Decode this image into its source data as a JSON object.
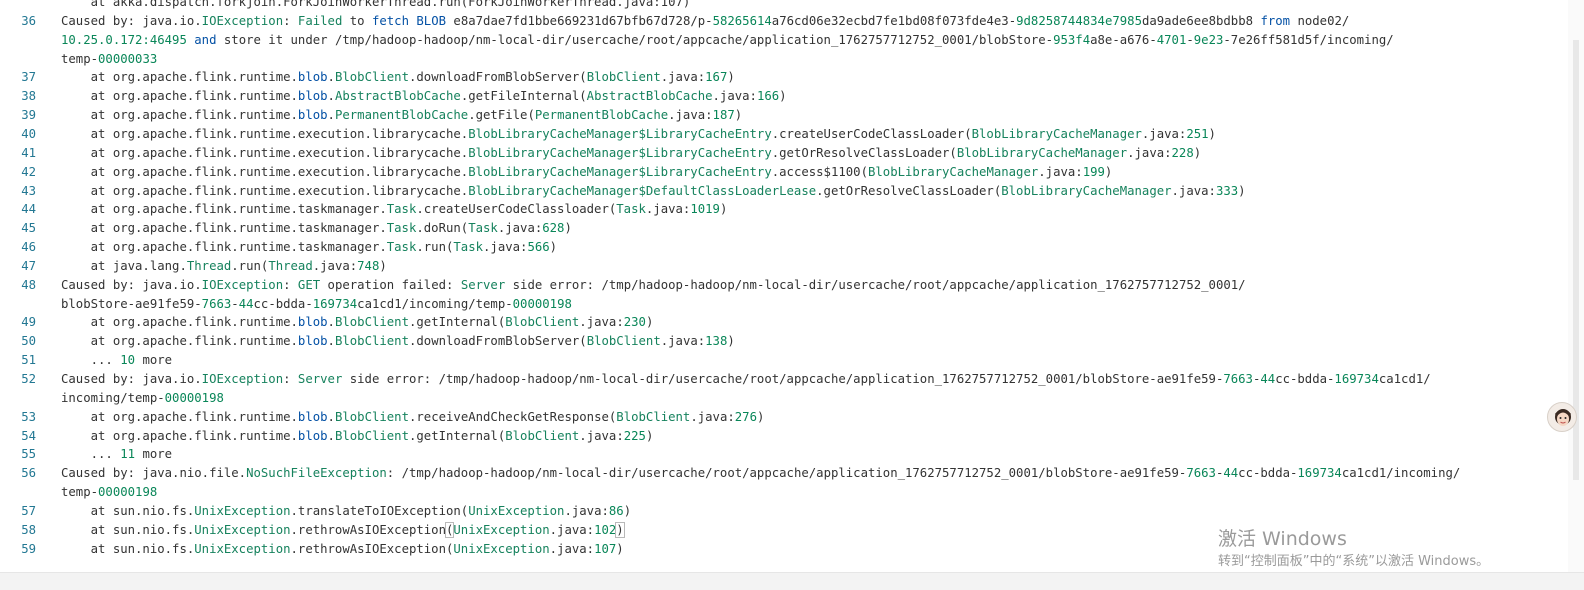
{
  "editor": {
    "lines": [
      {
        "num": "",
        "top": 0,
        "segments": [
          {
            "t": "    at akka.dispatch.forkjoin.ForkJoinWorkerThread.run(ForkJoinWorkerThread.java:107)"
          }
        ]
      },
      {
        "num": "36",
        "segments": [
          {
            "t": "Caused by: "
          },
          {
            "t": "java.io.",
            "c": "p"
          },
          {
            "t": "IOException",
            "c": "t"
          },
          {
            "t": ": "
          },
          {
            "t": "Failed",
            "c": "t"
          },
          {
            "t": " to "
          },
          {
            "t": "fetch",
            "c": "k"
          },
          {
            "t": " "
          },
          {
            "t": "BLOB",
            "c": "k"
          },
          {
            "t": " e8a7dae7fd1bbe669231d67bfb67d728/p-"
          },
          {
            "t": "58265614",
            "c": "n"
          },
          {
            "t": "a76cd06e32ecbd7fe1bd08f073fde4e3-"
          },
          {
            "t": "9d8258744834e7985",
            "c": "n"
          },
          {
            "t": "da9ade6ee8bdbb8 "
          },
          {
            "t": "from",
            "c": "k"
          },
          {
            "t": " node02/"
          }
        ]
      },
      {
        "num": "",
        "segments": [
          {
            "t": "10.25.0.172:46495",
            "c": "n"
          },
          {
            "t": " "
          },
          {
            "t": "and",
            "c": "k"
          },
          {
            "t": " store it under /tmp/hadoop-hadoop/nm-local-dir/usercache/root/appcache/application_1762757712752_0001/blobStore-"
          },
          {
            "t": "953f4",
            "c": "n"
          },
          {
            "t": "a8e-a676-"
          },
          {
            "t": "4701",
            "c": "n"
          },
          {
            "t": "-"
          },
          {
            "t": "9e23",
            "c": "n"
          },
          {
            "t": "-7e26ff581d5f/incoming/"
          }
        ]
      },
      {
        "num": "",
        "segments": [
          {
            "t": "temp-"
          },
          {
            "t": "00000033",
            "c": "n"
          }
        ]
      },
      {
        "num": "37",
        "segments": [
          {
            "t": "    at org.apache.flink.runtime."
          },
          {
            "t": "blob",
            "c": "k"
          },
          {
            "t": "."
          },
          {
            "t": "BlobClient",
            "c": "t"
          },
          {
            "t": ".downloadFromBlobServer("
          },
          {
            "t": "BlobClient",
            "c": "t"
          },
          {
            "t": ".java:"
          },
          {
            "t": "167",
            "c": "n"
          },
          {
            "t": ")"
          }
        ]
      },
      {
        "num": "38",
        "segments": [
          {
            "t": "    at org.apache.flink.runtime."
          },
          {
            "t": "blob",
            "c": "k"
          },
          {
            "t": "."
          },
          {
            "t": "AbstractBlobCache",
            "c": "t"
          },
          {
            "t": ".getFileInternal("
          },
          {
            "t": "AbstractBlobCache",
            "c": "t"
          },
          {
            "t": ".java:"
          },
          {
            "t": "166",
            "c": "n"
          },
          {
            "t": ")"
          }
        ]
      },
      {
        "num": "39",
        "segments": [
          {
            "t": "    at org.apache.flink.runtime."
          },
          {
            "t": "blob",
            "c": "k"
          },
          {
            "t": "."
          },
          {
            "t": "PermanentBlobCache",
            "c": "t"
          },
          {
            "t": ".getFile("
          },
          {
            "t": "PermanentBlobCache",
            "c": "t"
          },
          {
            "t": ".java:"
          },
          {
            "t": "187",
            "c": "n"
          },
          {
            "t": ")"
          }
        ]
      },
      {
        "num": "40",
        "segments": [
          {
            "t": "    at org.apache.flink.runtime.execution.librarycache."
          },
          {
            "t": "BlobLibraryCacheManager$LibraryCacheEntry",
            "c": "t"
          },
          {
            "t": ".createUserCodeClassLoader("
          },
          {
            "t": "BlobLibraryCacheManager",
            "c": "t"
          },
          {
            "t": ".java:"
          },
          {
            "t": "251",
            "c": "n"
          },
          {
            "t": ")"
          }
        ]
      },
      {
        "num": "41",
        "segments": [
          {
            "t": "    at org.apache.flink.runtime.execution.librarycache."
          },
          {
            "t": "BlobLibraryCacheManager$LibraryCacheEntry",
            "c": "t"
          },
          {
            "t": ".getOrResolveClassLoader("
          },
          {
            "t": "BlobLibraryCacheManager",
            "c": "t"
          },
          {
            "t": ".java:"
          },
          {
            "t": "228",
            "c": "n"
          },
          {
            "t": ")"
          }
        ]
      },
      {
        "num": "42",
        "segments": [
          {
            "t": "    at org.apache.flink.runtime.execution.librarycache."
          },
          {
            "t": "BlobLibraryCacheManager$LibraryCacheEntry",
            "c": "t"
          },
          {
            "t": ".access$1100("
          },
          {
            "t": "BlobLibraryCacheManager",
            "c": "t"
          },
          {
            "t": ".java:"
          },
          {
            "t": "199",
            "c": "n"
          },
          {
            "t": ")"
          }
        ]
      },
      {
        "num": "43",
        "segments": [
          {
            "t": "    at org.apache.flink.runtime.execution.librarycache."
          },
          {
            "t": "BlobLibraryCacheManager$DefaultClassLoaderLease",
            "c": "t"
          },
          {
            "t": ".getOrResolveClassLoader("
          },
          {
            "t": "BlobLibraryCacheManager",
            "c": "t"
          },
          {
            "t": ".java:"
          },
          {
            "t": "333",
            "c": "n"
          },
          {
            "t": ")"
          }
        ]
      },
      {
        "num": "44",
        "segments": [
          {
            "t": "    at org.apache.flink.runtime.taskmanager."
          },
          {
            "t": "Task",
            "c": "t"
          },
          {
            "t": ".createUserCodeClassloader("
          },
          {
            "t": "Task",
            "c": "t"
          },
          {
            "t": ".java:"
          },
          {
            "t": "1019",
            "c": "n"
          },
          {
            "t": ")"
          }
        ]
      },
      {
        "num": "45",
        "segments": [
          {
            "t": "    at org.apache.flink.runtime.taskmanager."
          },
          {
            "t": "Task",
            "c": "t"
          },
          {
            "t": ".doRun("
          },
          {
            "t": "Task",
            "c": "t"
          },
          {
            "t": ".java:"
          },
          {
            "t": "628",
            "c": "n"
          },
          {
            "t": ")"
          }
        ]
      },
      {
        "num": "46",
        "segments": [
          {
            "t": "    at org.apache.flink.runtime.taskmanager."
          },
          {
            "t": "Task",
            "c": "t"
          },
          {
            "t": ".run("
          },
          {
            "t": "Task",
            "c": "t"
          },
          {
            "t": ".java:"
          },
          {
            "t": "566",
            "c": "n"
          },
          {
            "t": ")"
          }
        ]
      },
      {
        "num": "47",
        "segments": [
          {
            "t": "    at java.lang."
          },
          {
            "t": "Thread",
            "c": "t"
          },
          {
            "t": ".run("
          },
          {
            "t": "Thread",
            "c": "t"
          },
          {
            "t": ".java:"
          },
          {
            "t": "748",
            "c": "n"
          },
          {
            "t": ")"
          }
        ]
      },
      {
        "num": "48",
        "segments": [
          {
            "t": "Caused by: "
          },
          {
            "t": "java.io."
          },
          {
            "t": "IOException",
            "c": "t"
          },
          {
            "t": ": "
          },
          {
            "t": "GET",
            "c": "t"
          },
          {
            "t": " operation failed: "
          },
          {
            "t": "Server",
            "c": "t"
          },
          {
            "t": " side error: /tmp/hadoop-hadoop/nm-local-dir/usercache/root/appcache/application_1762757712752_0001/"
          }
        ]
      },
      {
        "num": "",
        "segments": [
          {
            "t": "blobStore-ae91fe59-"
          },
          {
            "t": "7663",
            "c": "n"
          },
          {
            "t": "-"
          },
          {
            "t": "44",
            "c": "n"
          },
          {
            "t": "cc-bdda-"
          },
          {
            "t": "169734",
            "c": "n"
          },
          {
            "t": "ca1cd1/incoming/temp-"
          },
          {
            "t": "00000198",
            "c": "n"
          }
        ]
      },
      {
        "num": "49",
        "segments": [
          {
            "t": "    at org.apache.flink.runtime."
          },
          {
            "t": "blob",
            "c": "k"
          },
          {
            "t": "."
          },
          {
            "t": "BlobClient",
            "c": "t"
          },
          {
            "t": ".getInternal("
          },
          {
            "t": "BlobClient",
            "c": "t"
          },
          {
            "t": ".java:"
          },
          {
            "t": "230",
            "c": "n"
          },
          {
            "t": ")"
          }
        ]
      },
      {
        "num": "50",
        "segments": [
          {
            "t": "    at org.apache.flink.runtime."
          },
          {
            "t": "blob",
            "c": "k"
          },
          {
            "t": "."
          },
          {
            "t": "BlobClient",
            "c": "t"
          },
          {
            "t": ".downloadFromBlobServer("
          },
          {
            "t": "BlobClient",
            "c": "t"
          },
          {
            "t": ".java:"
          },
          {
            "t": "138",
            "c": "n"
          },
          {
            "t": ")"
          }
        ]
      },
      {
        "num": "51",
        "segments": [
          {
            "t": "    ... "
          },
          {
            "t": "10",
            "c": "n"
          },
          {
            "t": " more"
          }
        ]
      },
      {
        "num": "52",
        "segments": [
          {
            "t": "Caused by: "
          },
          {
            "t": "java.io."
          },
          {
            "t": "IOException",
            "c": "t"
          },
          {
            "t": ": "
          },
          {
            "t": "Server",
            "c": "t"
          },
          {
            "t": " side error: /tmp/hadoop-hadoop/nm-local-dir/usercache/root/appcache/application_1762757712752_0001/blobStore-ae91fe59-"
          },
          {
            "t": "7663",
            "c": "n"
          },
          {
            "t": "-"
          },
          {
            "t": "44",
            "c": "n"
          },
          {
            "t": "cc-bdda-"
          },
          {
            "t": "169734",
            "c": "n"
          },
          {
            "t": "ca1cd1/"
          }
        ]
      },
      {
        "num": "",
        "segments": [
          {
            "t": "incoming/temp-"
          },
          {
            "t": "00000198",
            "c": "n"
          }
        ]
      },
      {
        "num": "53",
        "segments": [
          {
            "t": "    at org.apache.flink.runtime."
          },
          {
            "t": "blob",
            "c": "k"
          },
          {
            "t": "."
          },
          {
            "t": "BlobClient",
            "c": "t"
          },
          {
            "t": ".receiveAndCheckGetResponse("
          },
          {
            "t": "BlobClient",
            "c": "t"
          },
          {
            "t": ".java:"
          },
          {
            "t": "276",
            "c": "n"
          },
          {
            "t": ")"
          }
        ]
      },
      {
        "num": "54",
        "segments": [
          {
            "t": "    at org.apache.flink.runtime."
          },
          {
            "t": "blob",
            "c": "k"
          },
          {
            "t": "."
          },
          {
            "t": "BlobClient",
            "c": "t"
          },
          {
            "t": ".getInternal("
          },
          {
            "t": "BlobClient",
            "c": "t"
          },
          {
            "t": ".java:"
          },
          {
            "t": "225",
            "c": "n"
          },
          {
            "t": ")"
          }
        ]
      },
      {
        "num": "55",
        "segments": [
          {
            "t": "    ... "
          },
          {
            "t": "11",
            "c": "n"
          },
          {
            "t": " more"
          }
        ]
      },
      {
        "num": "56",
        "segments": [
          {
            "t": "Caused by: "
          },
          {
            "t": "java.nio.file."
          },
          {
            "t": "NoSuchFileException",
            "c": "t"
          },
          {
            "t": ": /tmp/hadoop-hadoop/nm-local-dir/usercache/root/appcache/application_1762757712752_0001/blobStore-ae91fe59-"
          },
          {
            "t": "7663",
            "c": "n"
          },
          {
            "t": "-"
          },
          {
            "t": "44",
            "c": "n"
          },
          {
            "t": "cc-bdda-"
          },
          {
            "t": "169734",
            "c": "n"
          },
          {
            "t": "ca1cd1/incoming/"
          }
        ]
      },
      {
        "num": "",
        "segments": [
          {
            "t": "temp-"
          },
          {
            "t": "00000198",
            "c": "n"
          }
        ]
      },
      {
        "num": "57",
        "segments": [
          {
            "t": "    at sun.nio.fs."
          },
          {
            "t": "UnixException",
            "c": "t"
          },
          {
            "t": ".translateToIOException("
          },
          {
            "t": "UnixException",
            "c": "t"
          },
          {
            "t": ".java:"
          },
          {
            "t": "86",
            "c": "n"
          },
          {
            "t": ")"
          }
        ]
      },
      {
        "num": "58",
        "current": true,
        "segments": [
          {
            "t": "    at sun.nio.fs."
          },
          {
            "t": "UnixException",
            "c": "t"
          },
          {
            "t": ".rethrowAsIOException"
          },
          {
            "t": "(",
            "c": "bracket"
          },
          {
            "t": "UnixException",
            "c": "t"
          },
          {
            "t": ".java:"
          },
          {
            "t": "102",
            "c": "n"
          },
          {
            "t": ")",
            "c": "bracket"
          }
        ]
      },
      {
        "num": "59",
        "segments": [
          {
            "t": "    at sun.nio.fs."
          },
          {
            "t": "UnixException",
            "c": "t"
          },
          {
            "t": ".rethrowAsIOException("
          },
          {
            "t": "UnixException",
            "c": "t"
          },
          {
            "t": ".java:"
          },
          {
            "t": "107",
            "c": "n"
          },
          {
            "t": ")"
          }
        ]
      }
    ]
  },
  "watermark": {
    "line1": "激活 Windows",
    "line2": "转到“控制面板”中的“系统”以激活 Windows。"
  },
  "icons": {
    "avatar": "avatar-icon"
  }
}
